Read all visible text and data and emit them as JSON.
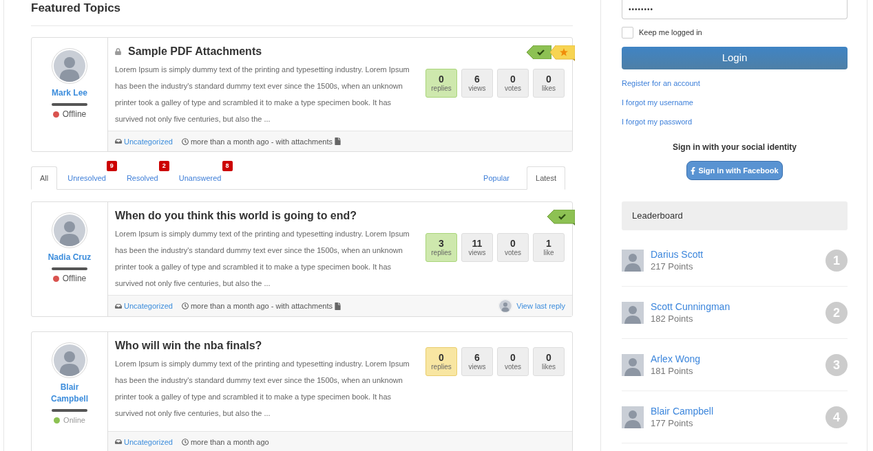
{
  "heading": "Featured Topics",
  "featured_topics": [
    {
      "title": "Sample PDF Attachments",
      "locked": true,
      "resolved": true,
      "featured": true,
      "excerpt": "Lorem Ipsum is simply dummy text of the printing and typesetting industry. Lorem Ipsum has been the industry's standard dummy text ever since the 1500s, when an unknown printer took a galley of type and scrambled it to make a type specimen book. It has survived not only five centuries, but also the ...",
      "author": {
        "name": "Mark Lee",
        "online": false,
        "status": "Offline"
      },
      "stats": [
        {
          "kind": "replies",
          "value": "0",
          "label": "replies"
        },
        {
          "kind": "count",
          "value": "6",
          "label": "views"
        },
        {
          "kind": "count",
          "value": "0",
          "label": "votes"
        },
        {
          "kind": "count",
          "value": "0",
          "label": "likes"
        }
      ],
      "category": "Uncategorized",
      "time": "more than a month ago - with attachments",
      "attachment": true
    }
  ],
  "filter_tabs": [
    {
      "label": "All",
      "selected": true
    },
    {
      "label": "Unresolved",
      "count": "9",
      "selected": false
    },
    {
      "label": "Resolved",
      "count": "2",
      "selected": false
    },
    {
      "label": "Unanswered",
      "count": "8",
      "selected": false
    }
  ],
  "sort_tabs": [
    {
      "label": "Popular",
      "selected": false
    },
    {
      "label": "Latest",
      "selected": true
    }
  ],
  "topics": [
    {
      "title": "When do you think this world is going to end?",
      "locked": false,
      "resolved": true,
      "featured": false,
      "excerpt": "Lorem Ipsum is simply dummy text of the printing and typesetting industry. Lorem Ipsum has been the industry's standard dummy text ever since the 1500s, when an unknown printer took a galley of type and scrambled it to make a type specimen book. It has survived not only five centuries, but also the ...",
      "author": {
        "name": "Nadia Cruz",
        "online": false,
        "status": "Offline"
      },
      "stats": [
        {
          "kind": "replies",
          "value": "3",
          "label": "replies"
        },
        {
          "kind": "count",
          "value": "11",
          "label": "views"
        },
        {
          "kind": "count",
          "value": "0",
          "label": "votes"
        },
        {
          "kind": "count",
          "value": "1",
          "label": "like"
        }
      ],
      "category": "Uncategorized",
      "time": "more than a month ago - with attachments",
      "attachment": true,
      "last_reply": "View last reply"
    },
    {
      "title": "Who will win the nba finals?",
      "locked": false,
      "resolved": false,
      "featured": false,
      "excerpt": "Lorem Ipsum is simply dummy text of the printing and typesetting industry. Lorem Ipsum has been the industry's standard dummy text ever since the 1500s, when an unknown printer took a galley of type and scrambled it to make a type specimen book. It has survived not only five centuries, but also the ...",
      "author": {
        "name": "Blair Campbell",
        "online": true,
        "status": "Online"
      },
      "stats": [
        {
          "kind": "replies",
          "value": "0",
          "label": "replies"
        },
        {
          "kind": "count",
          "value": "6",
          "label": "views"
        },
        {
          "kind": "count",
          "value": "0",
          "label": "votes"
        },
        {
          "kind": "count",
          "value": "0",
          "label": "likes"
        }
      ],
      "category": "Uncategorized",
      "time": "more than a month ago",
      "attachment": false
    }
  ],
  "login": {
    "password": "••••••••",
    "remember": {
      "label": "Keep me logged in",
      "checked": false
    },
    "login_button": "Login",
    "links": [
      "Register for an account",
      "I forgot my username",
      "I forgot my password"
    ],
    "social_heading": "Sign in with your social identity",
    "facebook_button": "Sign in with Facebook"
  },
  "leaderboard": {
    "title": "Leaderboard",
    "entries": [
      {
        "name": "Darius Scott",
        "points": "217 Points",
        "rank": "1"
      },
      {
        "name": "Scott Cunningman",
        "points": "182 Points",
        "rank": "2"
      },
      {
        "name": "Arlex Wong",
        "points": "181 Points",
        "rank": "3"
      },
      {
        "name": "Blair Campbell",
        "points": "177 Points",
        "rank": "4"
      }
    ]
  }
}
